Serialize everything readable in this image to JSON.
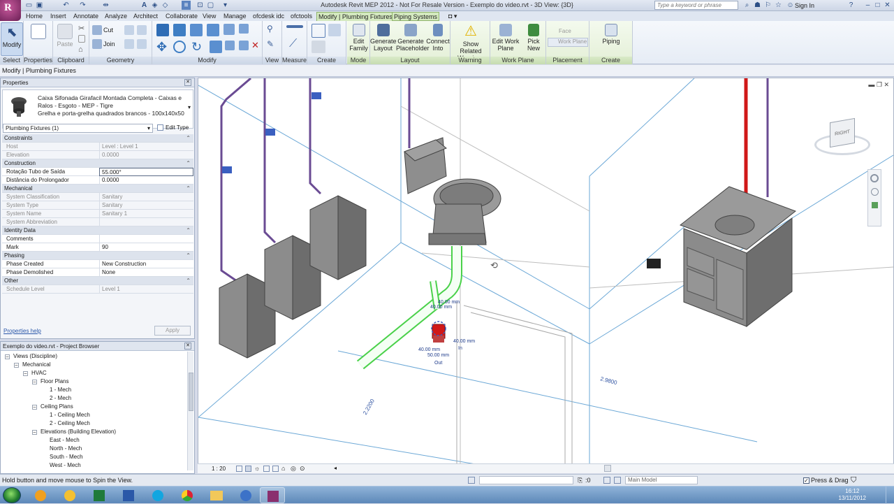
{
  "window": {
    "title": "Autodesk Revit MEP 2012 - Not For Resale Version -    Exemplo do video.rvt - 3D View: {3D}",
    "search_placeholder": "Type a keyword or phrase",
    "sign_in": "Sign In"
  },
  "tabs": [
    "Home",
    "Insert",
    "Annotate",
    "Analyze",
    "Architect",
    "Collaborate",
    "View",
    "Manage",
    "ofcdesk idc",
    "ofctools",
    "Modify | Plumbing Fixtures",
    "Piping Systems"
  ],
  "ribbon": {
    "modify_label": "Modify",
    "paste_label": "Paste",
    "cut_label": "Cut",
    "join_label": "Join",
    "panels": {
      "select": "Select",
      "properties": "Properties",
      "clipboard": "Clipboard",
      "geometry": "Geometry",
      "modify": "Modify",
      "view": "View",
      "measure": "Measure",
      "create": "Create",
      "mode": "Mode",
      "layout": "Layout",
      "warning": "Warning",
      "work_plane": "Work Plane",
      "placement": "Placement",
      "create_systems": "Create Systems"
    },
    "buttons": {
      "edit_family": "Edit Family",
      "generate_layout": "Generate Layout",
      "generate_placeholder": "Generate Placeholder",
      "connect_into": "Connect Into",
      "show_related_warnings": "Show Related Warnings",
      "edit_work_plane": "Edit Work Plane",
      "pick_new": "Pick New",
      "face": "Face",
      "work_plane": "Work Plane",
      "piping": "Piping"
    }
  },
  "options_bar": "Modify | Plumbing Fixtures",
  "properties": {
    "title": "Properties",
    "type_name": "Caixa Sifonada Girafacil Montada Completa - Caixas e Ralos - Esgoto - MEP - Tigre",
    "type_sub": "Grelha e porta-grelha quadrados brancos - 100x140x50",
    "instance_filter": "Plumbing Fixtures (1)",
    "edit_type": "Edit Type",
    "help": "Properties help",
    "apply": "Apply",
    "rows": [
      {
        "kind": "group",
        "k": "Constraints"
      },
      {
        "kind": "dim",
        "k": "Host",
        "v": "Level : Level 1"
      },
      {
        "kind": "dim",
        "k": "Elevation",
        "v": "0.0000"
      },
      {
        "kind": "group",
        "k": "Construction"
      },
      {
        "kind": "sel",
        "k": "Rotação Tubo de Saída",
        "v": "55.000°"
      },
      {
        "kind": "row",
        "k": "Distância do Prolongador",
        "v": "0.0000"
      },
      {
        "kind": "group",
        "k": "Mechanical"
      },
      {
        "kind": "dim",
        "k": "System Classification",
        "v": "Sanitary"
      },
      {
        "kind": "dim",
        "k": "System Type",
        "v": "Sanitary"
      },
      {
        "kind": "dim",
        "k": "System Name",
        "v": "Sanitary 1"
      },
      {
        "kind": "dim",
        "k": "System Abbreviation",
        "v": ""
      },
      {
        "kind": "group",
        "k": "Identity Data"
      },
      {
        "kind": "row",
        "k": "Comments",
        "v": ""
      },
      {
        "kind": "row",
        "k": "Mark",
        "v": "90"
      },
      {
        "kind": "group",
        "k": "Phasing"
      },
      {
        "kind": "row",
        "k": "Phase Created",
        "v": "New Construction"
      },
      {
        "kind": "row",
        "k": "Phase Demolished",
        "v": "None"
      },
      {
        "kind": "group",
        "k": "Other"
      },
      {
        "kind": "dim",
        "k": "Schedule Level",
        "v": "Level 1"
      }
    ]
  },
  "browser": {
    "title": "Exemplo do video.rvt - Project Browser",
    "items": [
      {
        "label": "Views (Discipline)",
        "indent": 0,
        "toggle": "-"
      },
      {
        "label": "Mechanical",
        "indent": 1,
        "toggle": "-"
      },
      {
        "label": "HVAC",
        "indent": 2,
        "toggle": "-"
      },
      {
        "label": "Floor Plans",
        "indent": 3,
        "toggle": "-"
      },
      {
        "label": "1 - Mech",
        "indent": 4,
        "toggle": ""
      },
      {
        "label": "2 - Mech",
        "indent": 4,
        "toggle": ""
      },
      {
        "label": "Ceiling Plans",
        "indent": 3,
        "toggle": "-"
      },
      {
        "label": "1 - Ceiling Mech",
        "indent": 4,
        "toggle": ""
      },
      {
        "label": "2 - Ceiling Mech",
        "indent": 4,
        "toggle": ""
      },
      {
        "label": "Elevations (Building Elevation)",
        "indent": 3,
        "toggle": "-"
      },
      {
        "label": "East - Mech",
        "indent": 4,
        "toggle": ""
      },
      {
        "label": "North - Mech",
        "indent": 4,
        "toggle": ""
      },
      {
        "label": "South - Mech",
        "indent": 4,
        "toggle": ""
      },
      {
        "label": "West - Mech",
        "indent": 4,
        "toggle": ""
      }
    ]
  },
  "viewport": {
    "scale": "1 : 20",
    "dim_1": "2.2200",
    "dim_2": "2.9800",
    "conn_labels": {
      "a": "40.00 mm",
      "b": "40.00 mm",
      "c": "40.00 mm",
      "d": "50.00 mm",
      "e": "40.00 mm",
      "in": "In",
      "out": "Out"
    },
    "viewcube_label": "RIGHT"
  },
  "status": {
    "message": "Hold button and move mouse to Spin the View.",
    "zero": ":0",
    "model": "Main Model",
    "press_drag": "Press & Drag"
  },
  "taskbar": {
    "time": "16:12",
    "date": "13/11/2012"
  },
  "colors": {
    "accent_pipe": "#d01818",
    "purple_pipe": "#6a4b93",
    "selected_green": "#4ad14a",
    "context_tab": "#d4e9bf"
  }
}
